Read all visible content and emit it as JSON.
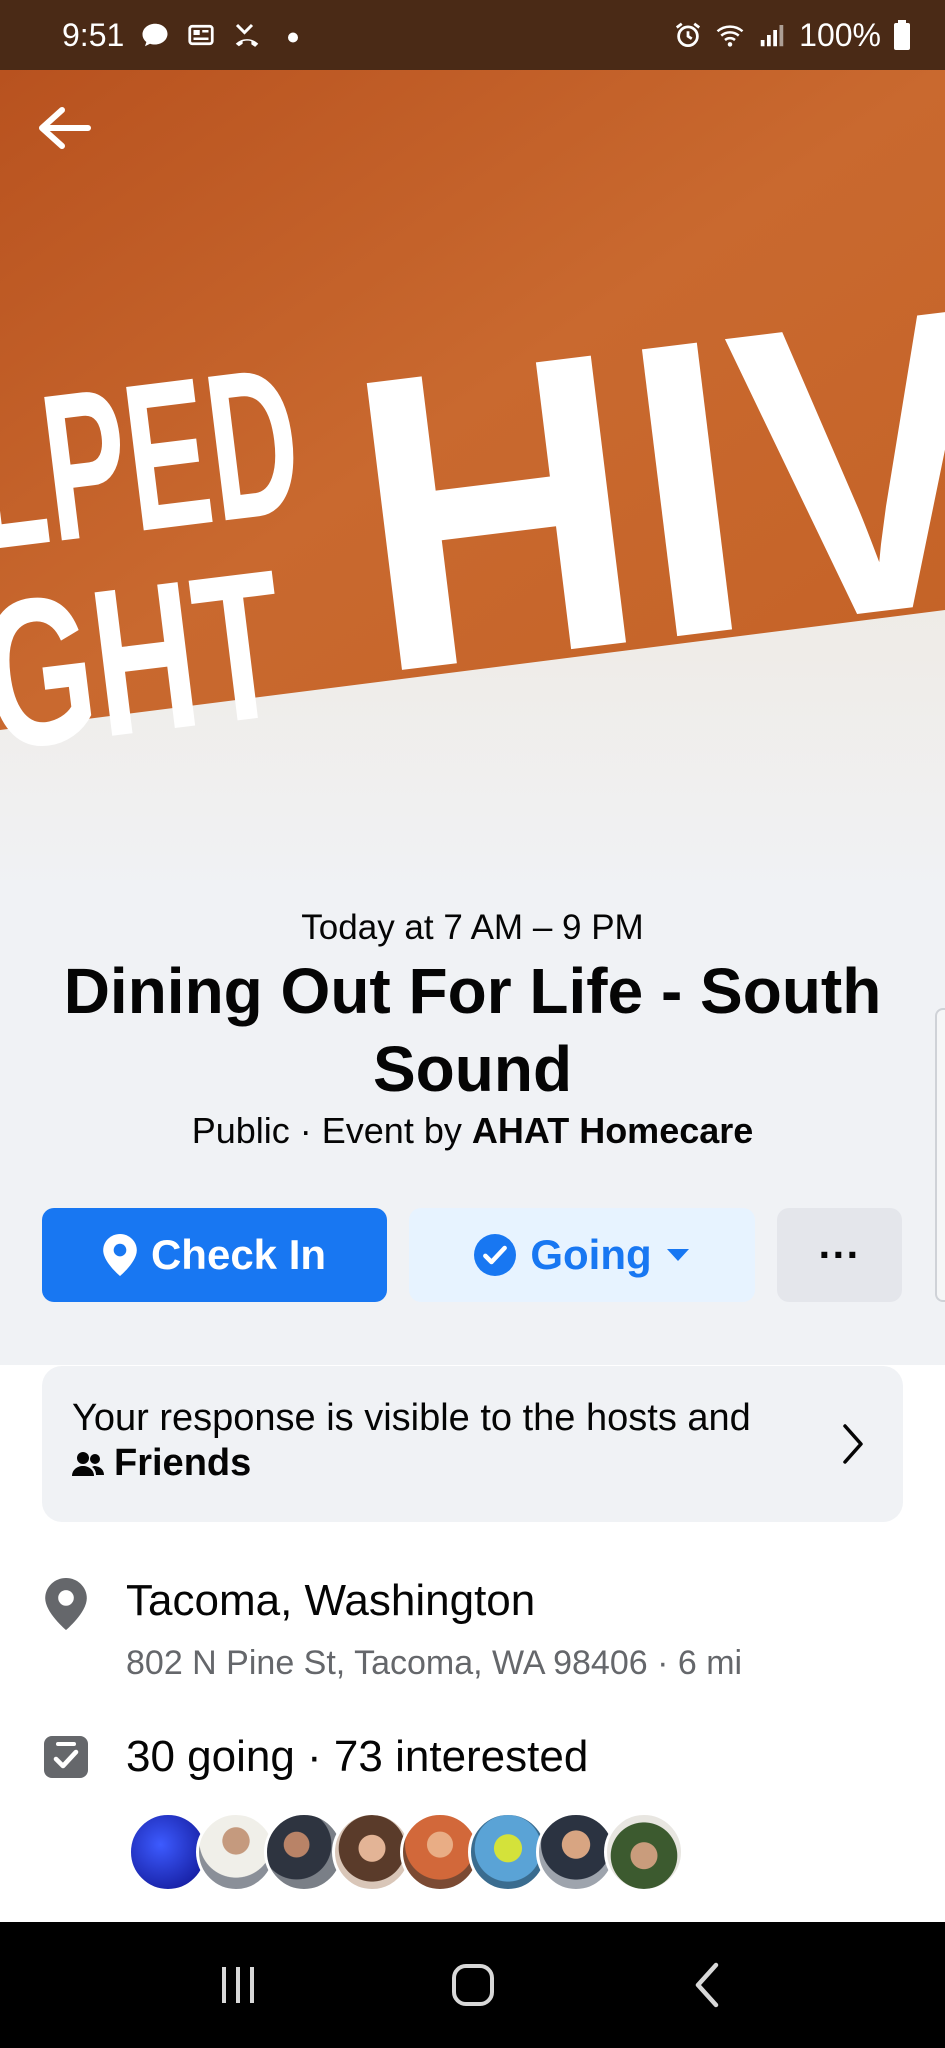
{
  "status_bar": {
    "time": "9:51",
    "battery": "100%",
    "left_icons": [
      "chat-icon",
      "news-icon",
      "missed-call-icon",
      "dot-icon"
    ],
    "right_icons": [
      "alarm-icon",
      "wifi-icon",
      "signal-icon",
      "battery-icon"
    ]
  },
  "cover": {
    "text_top_left": "LPED",
    "text_bottom_left": "GHT",
    "text_big": "HIV",
    "colors": {
      "orange": "#c3612a",
      "light": "#ede9e3"
    }
  },
  "event": {
    "time": "Today at 7 AM – 9 PM",
    "title": "Dining Out For Life - South Sound",
    "privacy": "Public",
    "separator": " · ",
    "event_by_label": "Event by",
    "host": "AHAT Homecare"
  },
  "actions": {
    "check_in_label": "Check In",
    "going_label": "Going",
    "more_label": "···"
  },
  "response": {
    "text": "Your response is visible to the hosts and",
    "audience": "Friends"
  },
  "location": {
    "name": "Tacoma, Washington",
    "address": "802 N Pine St, Tacoma, WA 98406 · 6 mi"
  },
  "attendance": {
    "summary": "30 going · 73 interested",
    "avatar_count": 8
  },
  "colors": {
    "accent": "#1877f2",
    "accent_light": "#e7f3ff",
    "secondary_text": "#65676b",
    "surface": "#f0f2f5"
  }
}
